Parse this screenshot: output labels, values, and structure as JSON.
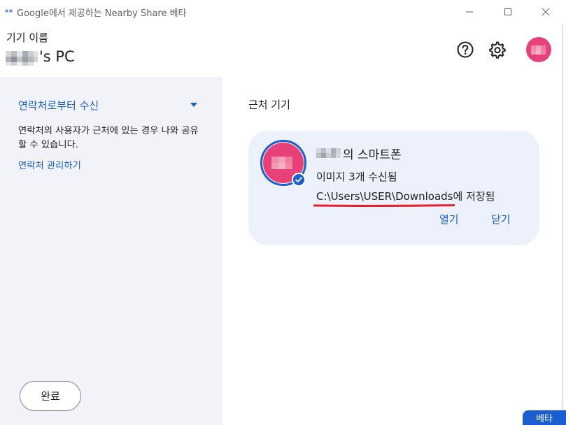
{
  "window": {
    "title": "Google에서 제공하는 Nearby Share 베타",
    "controls": [
      "minimize-icon",
      "maximize-icon",
      "close-icon"
    ]
  },
  "header": {
    "device_label": "기기 이름",
    "device_name": "'s PC",
    "icons": [
      "help-icon",
      "settings-icon",
      "avatar"
    ]
  },
  "left_panel": {
    "receive_mode": "연락처로부터 수신",
    "description": "연락처의 사용자가 근처에 있는 경우 나와 공유할 수 있습니다.",
    "manage_contacts": "연락처 관리하기",
    "done_button": "완료"
  },
  "right_panel": {
    "section_title": "근처 기기",
    "transfer": {
      "sender": "의 스마트폰",
      "status": "이미지 3개 수신됨",
      "save_path": "C:\\Users\\USER\\Downloads에 저장됨",
      "open_label": "열기",
      "close_label": "닫기"
    }
  },
  "badge": "베타",
  "colors": {
    "accent": "#1a5fd0",
    "avatar": "#e8417a",
    "card_bg": "#edf1fb",
    "panel_bg": "#f1f3f8",
    "annotation": "#e0232b"
  }
}
